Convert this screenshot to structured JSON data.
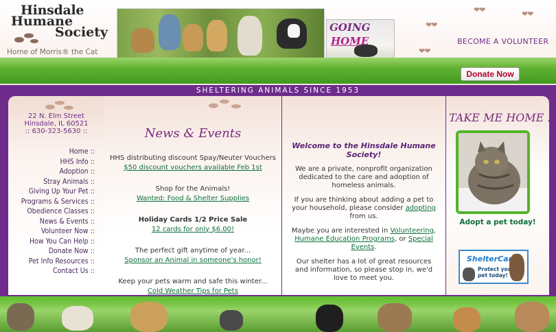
{
  "header": {
    "logo_line1": "Hinsdale",
    "logo_line2": "Humane",
    "logo_line3": "Society",
    "logo_sub": "Home of Morris® the Cat",
    "going_home_1": "GOING",
    "going_home_2": "HOME",
    "volunteer_link": "BECOME A VOLUNTEER",
    "donate_button": "Donate Now",
    "banner": "SHELTERING ANIMALS SINCE 1953"
  },
  "sidebar": {
    "address": [
      "22 N. Elm Street",
      "Hinsdale, IL 60521",
      ":: 630-323-5630 ::"
    ],
    "items": [
      {
        "label": "Home ::"
      },
      {
        "label": "HHS Info ::"
      },
      {
        "label": "Adoption ::"
      },
      {
        "label": "Stray Animals ::"
      },
      {
        "label": "Giving Up Your Pet ::"
      },
      {
        "label": "Programs & Services ::"
      },
      {
        "label": "Obedience Classes ::"
      },
      {
        "label": "News & Events ::"
      },
      {
        "label": "Volunteer Now ::"
      },
      {
        "label": "How You Can Help ::"
      },
      {
        "label": "Donate Now ::"
      },
      {
        "label": "Pet Info Resources ::"
      },
      {
        "label": "Contact Us ::"
      }
    ]
  },
  "news": {
    "title": "News & Events",
    "items": [
      {
        "text": "HHS distributing discount Spay/Neuter Vouchers",
        "link": "$50 discount vouchers available Feb 1st"
      },
      {
        "text": "Shop for the Animals!",
        "link": "Wanted: Food & Shelter Supplies"
      },
      {
        "text": "Holiday Cards 1/2 Price Sale",
        "link": "12 cards for only $6.00!"
      },
      {
        "text": "The perfect gift anytime of year...",
        "link": "Sponsor an Animal in someone's honor!"
      },
      {
        "text": "Keep your pets warm and safe this winter...",
        "link": "Cold Weather Tips for Pets"
      }
    ]
  },
  "welcome": {
    "title": "Welcome to the Hinsdale Humane Society!",
    "p1": "We are a private, nonprofit organization dedicated to the care and adoption of homeless animals.",
    "p2_pre": "If you are thinking about adding a pet to your household, please consider",
    "p2_link": "adopting",
    "p2_post": "from us.",
    "p3_pre": "Maybe you are interested in",
    "p3_link1": "Volunteering",
    "p3_link2": "Humane Education Programs",
    "p3_mid": ", or",
    "p3_link3": "Special Events",
    "p4": "Our shelter has a lot of great resources and information, so please stop in, we'd love to meet you."
  },
  "takeme": {
    "title": "TAKE ME HOME ::",
    "adopt_link": "Adopt a pet today!",
    "shelter_brand": "ShelterCare",
    "shelter_line1": "Protect your",
    "shelter_line2": "pet today!"
  },
  "colors": {
    "purple": "#6d2c8c",
    "green_link": "#0d6f3b",
    "grass": "#62b233"
  }
}
